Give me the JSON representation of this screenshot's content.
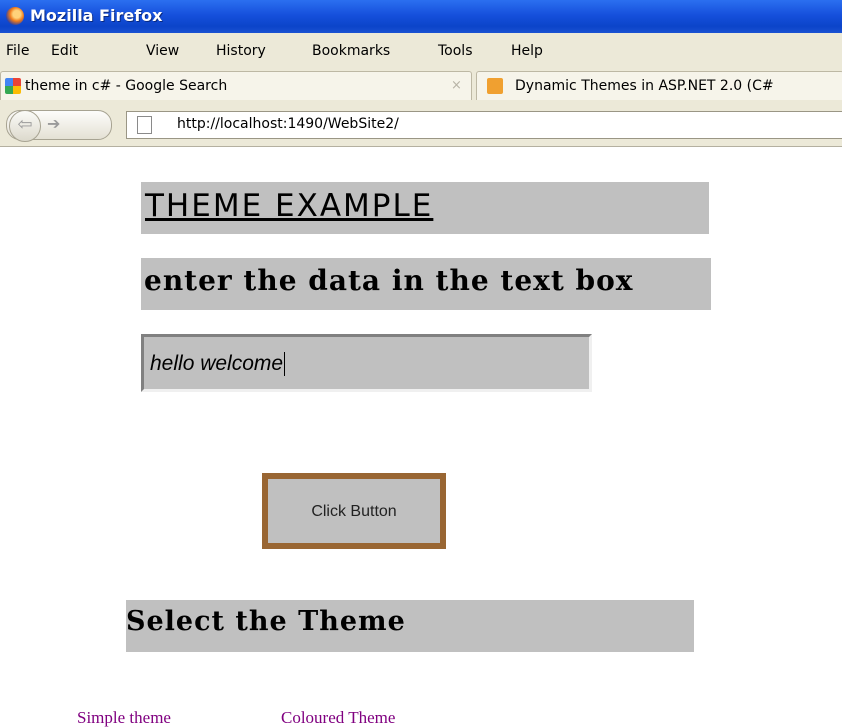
{
  "window": {
    "title": "Mozilla Firefox"
  },
  "menu": [
    "File",
    "Edit",
    "View",
    "History",
    "Bookmarks",
    "Tools",
    "Help"
  ],
  "tabs": [
    {
      "label": "theme in c# - Google Search",
      "close": "×"
    },
    {
      "label": "Dynamic Themes in ASP.NET 2.0 (C#"
    }
  ],
  "nav": {
    "back": "⇦",
    "forward": "➔",
    "url": "http://localhost:1490/WebSite2/"
  },
  "page": {
    "heading": "THEME EXAMPLE",
    "instruction": "enter the data in the text box",
    "textbox_value": "hello welcome",
    "button_label": "Click Button",
    "select_label": "Select the Theme",
    "theme_links": [
      "Simple theme",
      "Coloured Theme"
    ]
  },
  "colors": {
    "panel_bg": "#c0c0c0",
    "button_border": "#996633",
    "link": "#800080",
    "titlebar": "#0b44c9",
    "chrome": "#ece9d8"
  },
  "icons": [
    "firefox-logo-icon",
    "google-favicon-icon",
    "site-favicon-icon",
    "back-arrow-icon",
    "forward-arrow-icon",
    "page-icon"
  ]
}
